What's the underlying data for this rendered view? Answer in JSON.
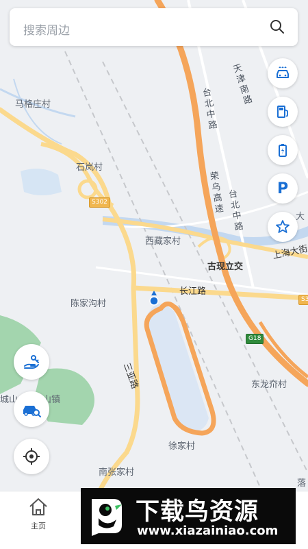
{
  "search": {
    "placeholder": "搜索周边"
  },
  "map_labels": {
    "maguzhuang": "马格庄村",
    "shilancun": "石岚村",
    "s302": "S302",
    "xizangjiacun": "西藏家村",
    "guxianlijiao": "古现立交",
    "changjianglu": "长江路",
    "chenjiagoucun": "陈家沟村",
    "sanyelu": "三亚路",
    "g18": "G18",
    "donglongjiecun": "东龙夼村",
    "xujiacun": "徐家村",
    "nanzhangjiacun": "南张家村",
    "shanghaida": "上海大街",
    "tianjinnanlu": "天津南路",
    "taibeizhonglu_1": "台北中路",
    "taibeizhonglu_2": "台北中路",
    "rongwugaosu": "荣乌高速",
    "s3_right": "S3",
    "da": "大",
    "luo": "落",
    "town_partial": "山镇",
    "town_left": "城山"
  },
  "right_buttons": [
    "car-wash",
    "gas-station",
    "charging-station",
    "parking",
    "favorites"
  ],
  "right_parking_label": "P",
  "left_buttons": [
    "car-service",
    "car-search",
    "locate"
  ],
  "tabbar": {
    "home_label": "主页"
  },
  "watermark": {
    "title": "下载鸟资源",
    "url": "www.xiazainiao.com"
  },
  "colors": {
    "highway": "#f5a55a",
    "major_road": "#fbd98d",
    "water": "#dbe7f5",
    "river": "#bcd3ee",
    "green": "#9bd1a8",
    "accent": "#1a6fd4"
  }
}
